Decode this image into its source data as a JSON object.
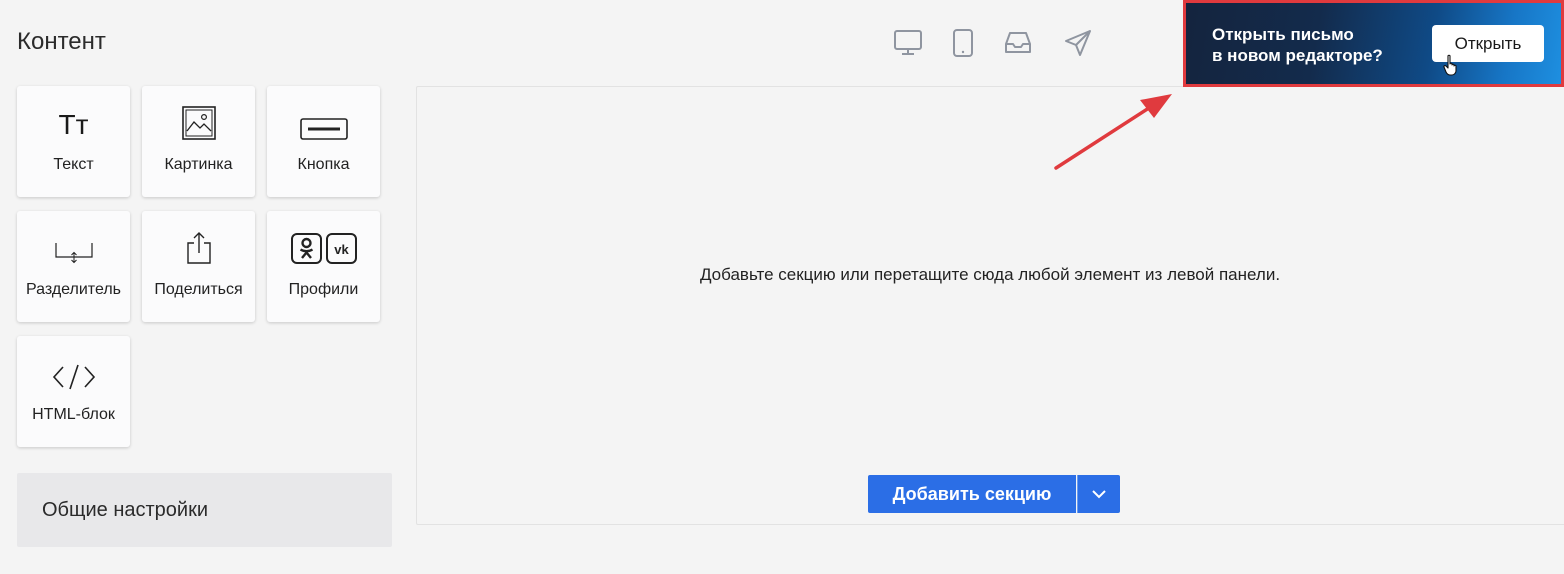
{
  "panel": {
    "title": "Контент"
  },
  "blocks": [
    {
      "label": "Текст",
      "icon": "text-format-icon",
      "glyph": "Тт"
    },
    {
      "label": "Картинка",
      "icon": "image-icon"
    },
    {
      "label": "Кнопка",
      "icon": "button-icon"
    },
    {
      "label": "Разделитель",
      "icon": "divider-icon"
    },
    {
      "label": "Поделиться",
      "icon": "share-icon"
    },
    {
      "label": "Профили",
      "icon": "social-profiles-icon"
    },
    {
      "label": "HTML-блок",
      "icon": "code-icon"
    }
  ],
  "settings": {
    "label": "Общие настройки"
  },
  "toolbar": {
    "icons": [
      "desktop-icon",
      "mobile-icon",
      "inbox-icon",
      "send-icon"
    ]
  },
  "canvas": {
    "hint": "Добавьте секцию или перетащите сюда любой элемент из левой панели.",
    "add_section_label": "Добавить секцию"
  },
  "banner": {
    "line1": "Открыть письмо",
    "line2": "в новом редакторе?",
    "button_label": "Открыть"
  },
  "colors": {
    "accent": "#2b6ee6",
    "highlight": "#e03a3e",
    "background": "#f4f4f4"
  }
}
